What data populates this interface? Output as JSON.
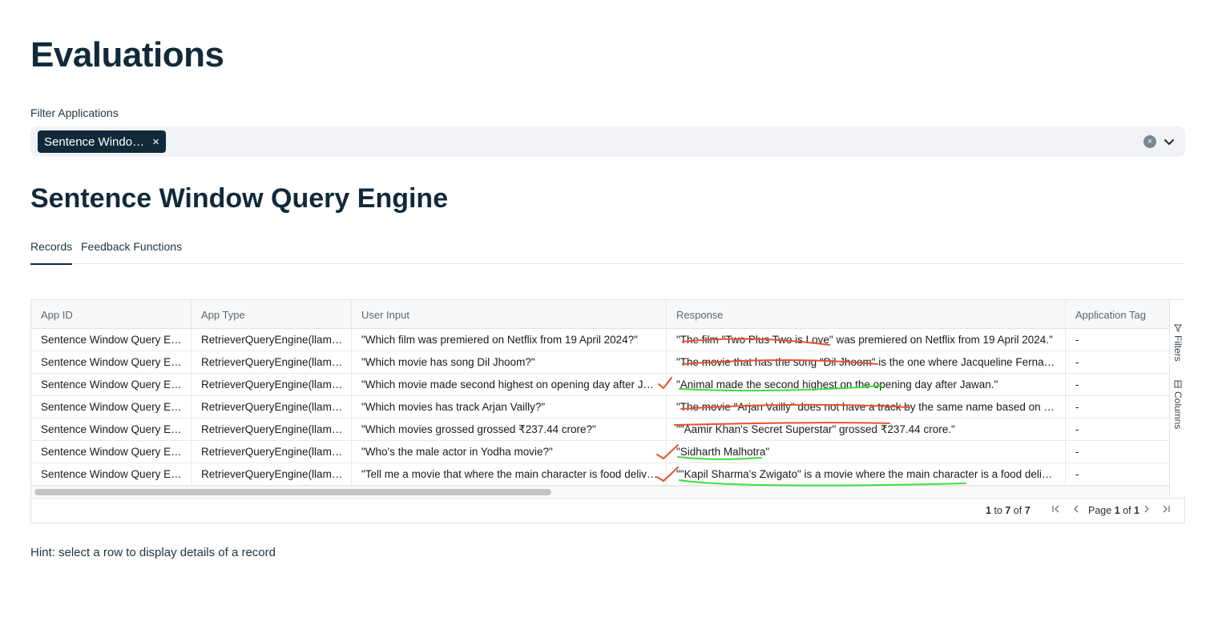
{
  "page": {
    "title": "Evaluations"
  },
  "filter": {
    "label": "Filter Applications",
    "chip": "Sentence Windo…",
    "chip_remove": "×",
    "clear_icon": "×"
  },
  "section": {
    "title": "Sentence Window Query Engine"
  },
  "tabs": [
    {
      "label": "Records",
      "active": true
    },
    {
      "label": "Feedback Functions",
      "active": false
    }
  ],
  "table": {
    "columns": [
      "App ID",
      "App Type",
      "User Input",
      "Response",
      "Application Tag"
    ],
    "rows": [
      [
        "Sentence Window Query En…",
        "RetrieverQueryEngine(llama…",
        "\"Which film was premiered on Netflix from 19 April 2024?\"",
        "\"The film \"Two Plus Two is Love\" was premiered on Netflix from 19 April 2024.\"",
        "-"
      ],
      [
        "Sentence Window Query En…",
        "RetrieverQueryEngine(llama…",
        "\"Which movie has song Dil Jhoom?\"",
        "\"The movie that has the song \"Dil Jhoom\" is the one where Jacqueline Fernande…",
        "-"
      ],
      [
        "Sentence Window Query En…",
        "RetrieverQueryEngine(llama…",
        "\"Which movie made second highest on opening day after Jawa…",
        "\"Animal made the second highest on the opening day after Jawan.\"",
        "-"
      ],
      [
        "Sentence Window Query En…",
        "RetrieverQueryEngine(llama…",
        "\"Which movies has track Arjan Vailly?\"",
        "\"The movie \"Arjan Vailly\" does not have a track by the same name based on the p…",
        "-"
      ],
      [
        "Sentence Window Query En…",
        "RetrieverQueryEngine(llama…",
        "\"Which movies grossed grossed ₹237.44 crore?\"",
        "\"\"Aamir Khan's Secret Superstar\" grossed ₹237.44 crore.\"",
        "-"
      ],
      [
        "Sentence Window Query En…",
        "RetrieverQueryEngine(llama…",
        "\"Who's the male actor in Yodha movie?\"",
        "\"Sidharth Malhotra\"",
        "-"
      ],
      [
        "Sentence Window Query En…",
        "RetrieverQueryEngine(llama…",
        "\"Tell me a movie that where the main character is food deliver…",
        "\"\"Kapil Sharma's Zwigato\" is a movie where the main character is a food delivery …",
        "-"
      ]
    ],
    "side_panel": {
      "filters": "Filters",
      "columns": "Columns"
    },
    "pagination": {
      "from": "1",
      "to_word": "to",
      "to": "7",
      "of_word": "of",
      "total": "7",
      "page_word": "Page",
      "page": "1",
      "pages": "1"
    }
  },
  "hint": "Hint: select a row to display details of a record",
  "colors": {
    "primary": "#112a3a",
    "annotation_red": "#e8502e",
    "annotation_green": "#3fdc3f"
  },
  "icons": [
    "clear-icon",
    "chevron-down-icon",
    "filter-icon",
    "columns-icon",
    "first-page-icon",
    "prev-page-icon",
    "next-page-icon",
    "last-page-icon"
  ]
}
